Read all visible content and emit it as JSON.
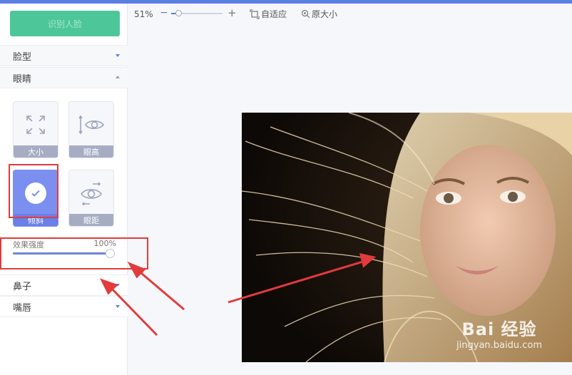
{
  "sidebar": {
    "primary_button": "识别人脸",
    "sections": {
      "face_shape": "脸型",
      "eyes": "眼睛",
      "nose": "鼻子",
      "lips": "嘴唇"
    },
    "eye_tools": [
      {
        "label": "大小",
        "icon": "expand-arrows-icon",
        "active": false
      },
      {
        "label": "眼高",
        "icon": "eye-height-icon",
        "active": false
      },
      {
        "label": "倾斜",
        "icon": "check-icon",
        "active": true
      },
      {
        "label": "眼距",
        "icon": "eye-distance-icon",
        "active": false
      }
    ],
    "slider": {
      "title": "效果强度",
      "value_text": "100%",
      "value": 1.0
    }
  },
  "toolbar": {
    "zoom_percent": "51%",
    "zoom_minus": "−",
    "zoom_plus": "+",
    "zoom_level": 0.51,
    "fit_label": "自适应",
    "original_label": "原大小"
  },
  "watermark": {
    "logo": "Bai 经验",
    "url": "jingyan.baidu.com"
  },
  "colors": {
    "accent": "#5b7fe6",
    "primary_button": "#4dc79a",
    "active_tile": "#7b8ff0",
    "annotation_red": "#e23b3b"
  }
}
